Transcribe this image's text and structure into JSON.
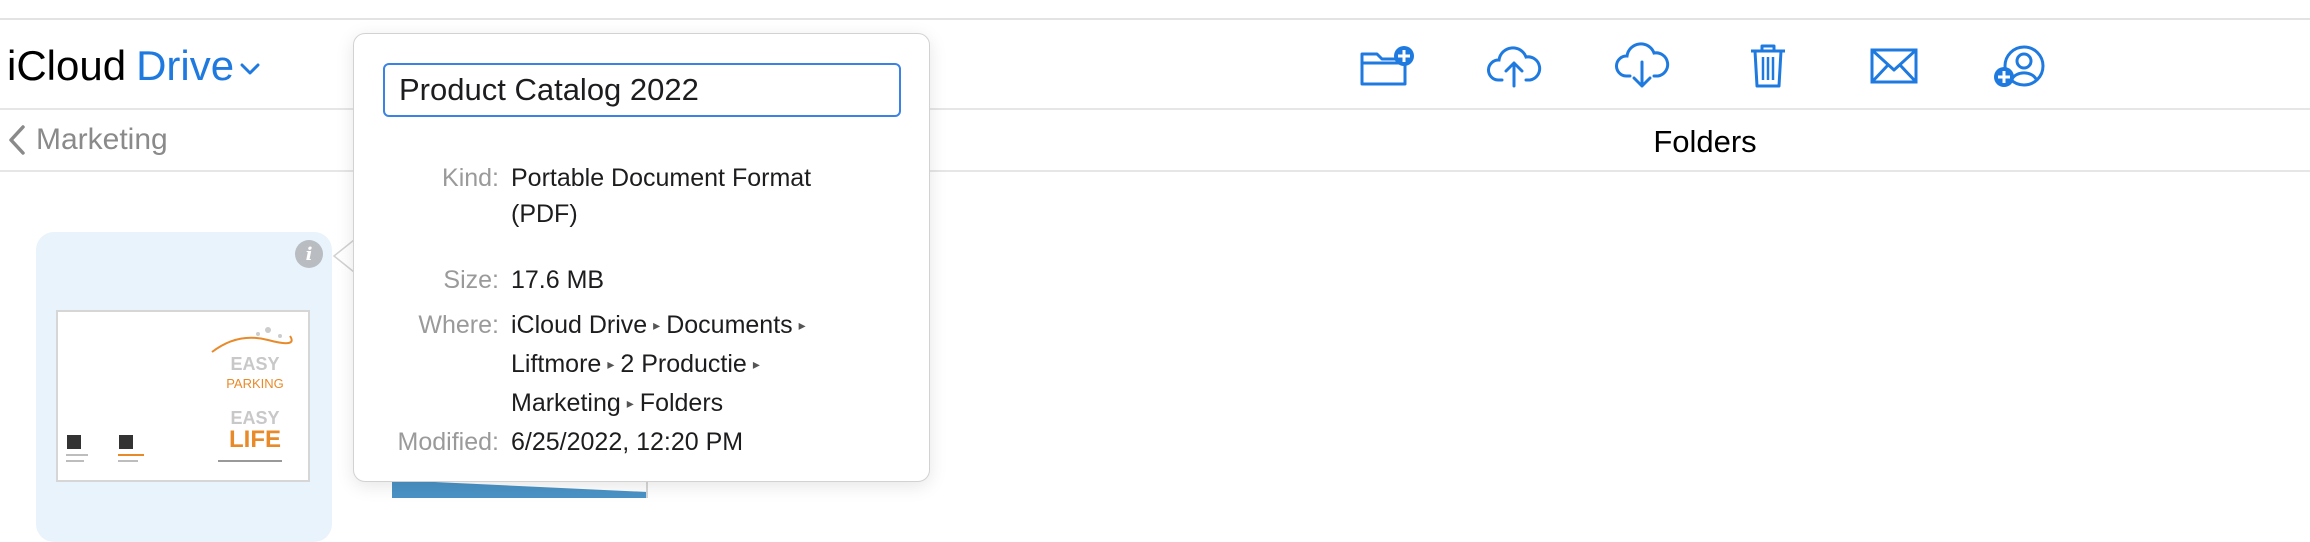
{
  "app": {
    "title_part1": "iCloud",
    "title_part2": "Drive"
  },
  "toolbar": {
    "icons": [
      "new-folder-icon",
      "upload-icon",
      "download-icon",
      "trash-icon",
      "mail-icon",
      "share-user-icon"
    ]
  },
  "nav": {
    "back_label": "Marketing",
    "view_title": "Folders"
  },
  "popover": {
    "name_value": "Product Catalog 2022",
    "kind_label": "Kind:",
    "kind_line1": "Portable Document Format",
    "kind_line2": "(PDF)",
    "size_label": "Size:",
    "size_value": "17.6 MB",
    "where_label": "Where:",
    "where_path": [
      "iCloud Drive",
      "Documents",
      "Liftmore",
      "2 Productie",
      "Marketing",
      "Folders"
    ],
    "modified_label": "Modified:",
    "modified_value": "6/25/2022, 12:20 PM"
  },
  "thumbnail": {
    "line1": "EASY",
    "line2": "PARKING",
    "line3": "EASY",
    "line4": "LIFE"
  },
  "colors": {
    "accent": "#1f7ae0",
    "field_border": "#3b82e6",
    "tile_bg": "#e8f3fb",
    "thumb_orange": "#e88a2a"
  }
}
